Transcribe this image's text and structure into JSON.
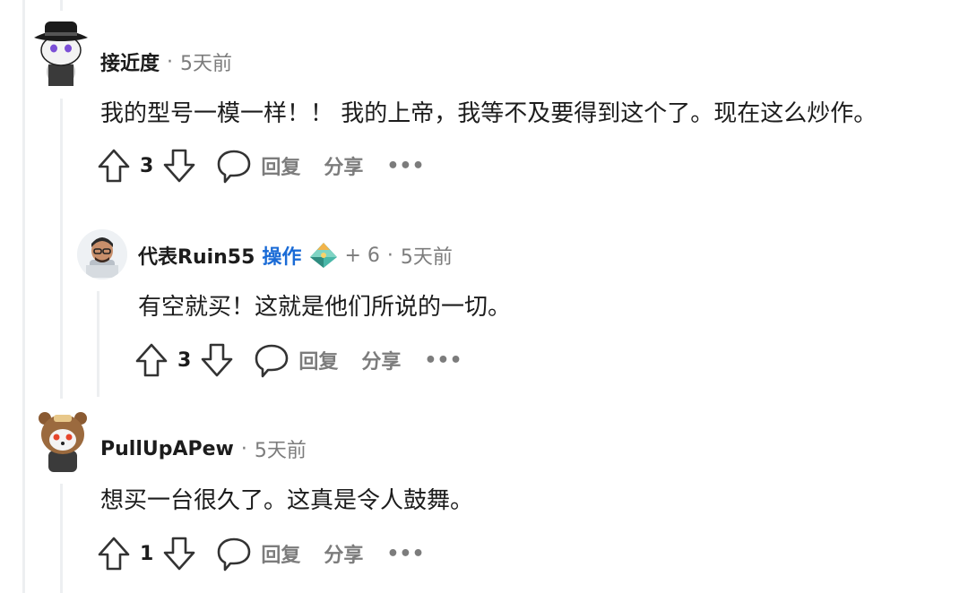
{
  "comments": [
    {
      "author": "接近度",
      "separator": "·",
      "time": "5天前",
      "text": "我的型号一模一样！！ 我的上帝，我等不及要得到这个了。现在这么炒作。",
      "votes": "3",
      "reply_label": "回复",
      "share_label": "分享",
      "more_label": "•••"
    },
    {
      "author": "代表Ruin55",
      "mod_badge": "操作",
      "karma": "+ 6",
      "separator": "·",
      "time": "5天前",
      "text": "有空就买！这就是他们所说的一切。",
      "votes": "3",
      "reply_label": "回复",
      "share_label": "分享",
      "more_label": "•••"
    },
    {
      "author": "PullUpAPew",
      "separator": "·",
      "time": "5天前",
      "text": "想买一台很久了。这真是令人鼓舞。",
      "votes": "1",
      "reply_label": "回复",
      "share_label": "分享",
      "more_label": "•••"
    }
  ],
  "colors": {
    "mod_blue": "#1a6bd6",
    "meta_gray": "#7c7c7c",
    "thread_line": "#edeff1"
  }
}
